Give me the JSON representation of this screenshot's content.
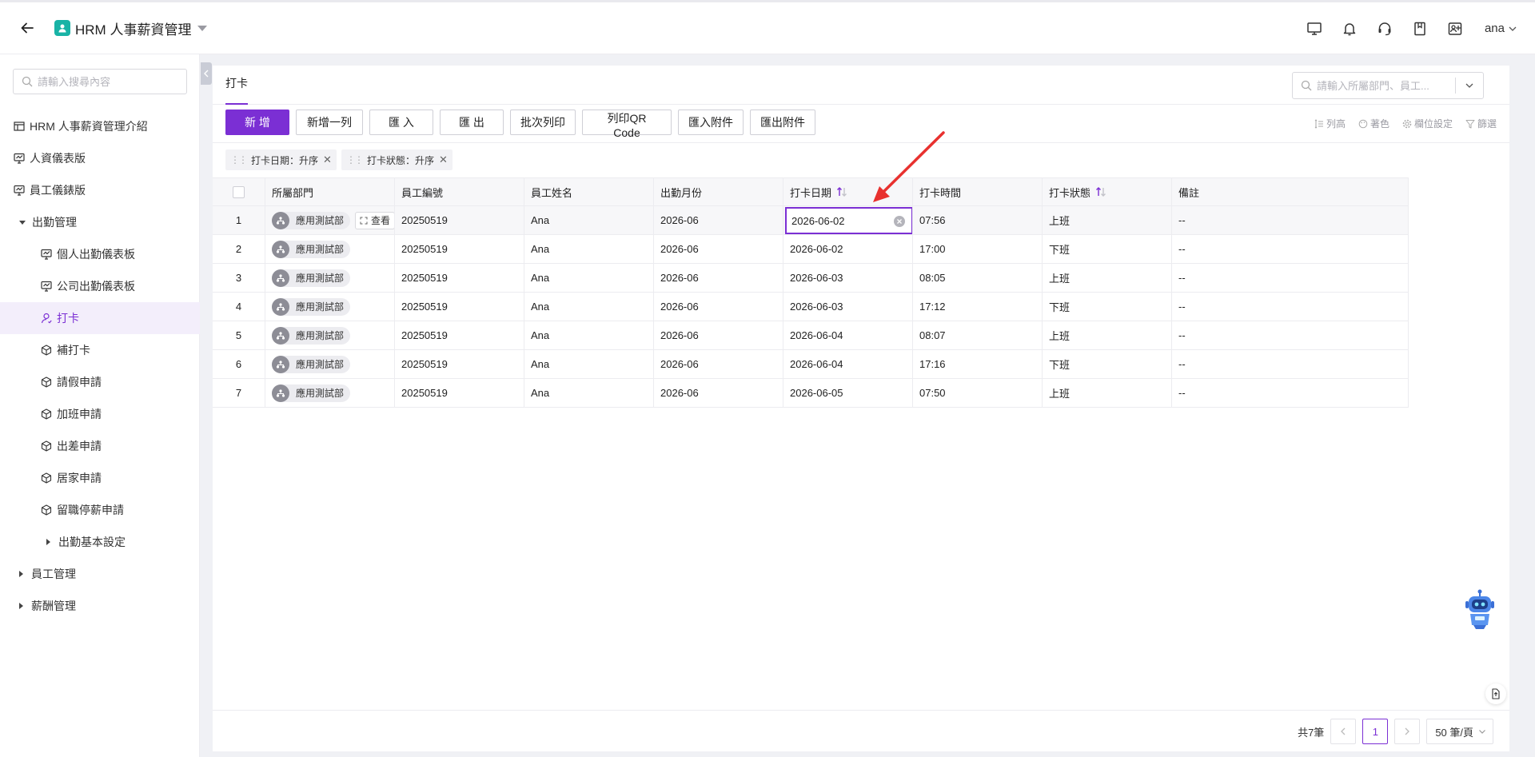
{
  "app": {
    "title": "HRM 人事薪資管理"
  },
  "user": {
    "name": "ana"
  },
  "sidebar": {
    "search_placeholder": "請輸入搜尋內容",
    "items": [
      {
        "label": "HRM 人事薪資管理介紹",
        "icon": "table-icon"
      },
      {
        "label": "人資儀表版",
        "icon": "dashboard-icon"
      },
      {
        "label": "員工儀錶版",
        "icon": "dashboard-icon"
      },
      {
        "label": "出勤管理",
        "icon": "caret-down"
      },
      {
        "label": "個人出勤儀表板",
        "icon": "dashboard-icon"
      },
      {
        "label": "公司出勤儀表板",
        "icon": "dashboard-icon"
      },
      {
        "label": "打卡",
        "icon": "user-icon",
        "active": true
      },
      {
        "label": "補打卡",
        "icon": "cube-icon"
      },
      {
        "label": "請假申請",
        "icon": "cube-icon"
      },
      {
        "label": "加班申請",
        "icon": "cube-icon"
      },
      {
        "label": "出差申請",
        "icon": "cube-icon"
      },
      {
        "label": "居家申請",
        "icon": "cube-icon"
      },
      {
        "label": "留職停薪申請",
        "icon": "cube-icon"
      },
      {
        "label": "出勤基本設定",
        "icon": "caret-right"
      },
      {
        "label": "員工管理",
        "icon": "caret-right"
      },
      {
        "label": "薪酬管理",
        "icon": "caret-right"
      }
    ]
  },
  "main": {
    "tab": "打卡",
    "search_placeholder": "請輸入所屬部門、員工...",
    "toolbar": {
      "add": "新 增",
      "add_row": "新增一列",
      "import": "匯 入",
      "export": "匯 出",
      "batch_print": "批次列印",
      "print_qr": "列印QR Code",
      "import_attach": "匯入附件",
      "export_attach": "匯出附件"
    },
    "tools": {
      "row_height": "列高",
      "color": "著色",
      "field_settings": "欄位設定",
      "filter": "篩選"
    },
    "sort_chips": [
      {
        "label": "打卡日期：升序"
      },
      {
        "label": "打卡狀態：升序"
      }
    ],
    "columns": [
      "所屬部門",
      "員工編號",
      "員工姓名",
      "出勤月份",
      "打卡日期",
      "打卡時間",
      "打卡狀態",
      "備註"
    ],
    "view_label": "查看",
    "rows": [
      {
        "no": "1",
        "dept": "應用測試部",
        "emp_no": "20250519",
        "name": "Ana",
        "month": "2026-06",
        "date": "2026-06-02",
        "time": "07:56",
        "status": "上班",
        "note": "--"
      },
      {
        "no": "2",
        "dept": "應用測試部",
        "emp_no": "20250519",
        "name": "Ana",
        "month": "2026-06",
        "date": "2026-06-02",
        "time": "17:00",
        "status": "下班",
        "note": "--"
      },
      {
        "no": "3",
        "dept": "應用測試部",
        "emp_no": "20250519",
        "name": "Ana",
        "month": "2026-06",
        "date": "2026-06-03",
        "time": "08:05",
        "status": "上班",
        "note": "--"
      },
      {
        "no": "4",
        "dept": "應用測試部",
        "emp_no": "20250519",
        "name": "Ana",
        "month": "2026-06",
        "date": "2026-06-03",
        "time": "17:12",
        "status": "下班",
        "note": "--"
      },
      {
        "no": "5",
        "dept": "應用測試部",
        "emp_no": "20250519",
        "name": "Ana",
        "month": "2026-06",
        "date": "2026-06-04",
        "time": "08:07",
        "status": "上班",
        "note": "--"
      },
      {
        "no": "6",
        "dept": "應用測試部",
        "emp_no": "20250519",
        "name": "Ana",
        "month": "2026-06",
        "date": "2026-06-04",
        "time": "17:16",
        "status": "下班",
        "note": "--"
      },
      {
        "no": "7",
        "dept": "應用測試部",
        "emp_no": "20250519",
        "name": "Ana",
        "month": "2026-06",
        "date": "2026-06-05",
        "time": "07:50",
        "status": "上班",
        "note": "--"
      }
    ],
    "pagination": {
      "total": "共7筆",
      "current": "1",
      "page_size": "50 筆/頁"
    }
  },
  "colors": {
    "accent": "#7b2fd4",
    "logo": "#19b3a6",
    "annotation": "#e8312f"
  }
}
